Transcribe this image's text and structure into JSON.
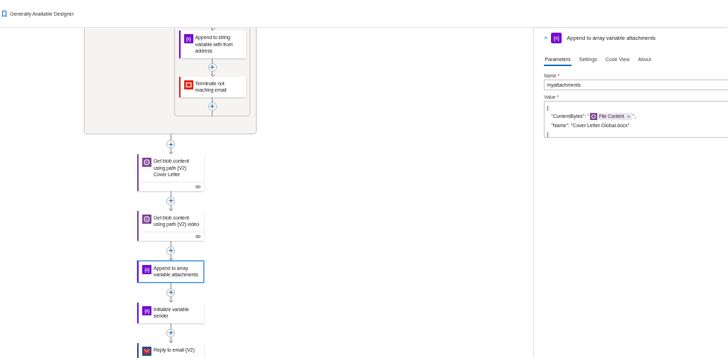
{
  "top_bar": {
    "title": "Generally Available Designer"
  },
  "scope_actions": [
    {
      "title": "Append to string variable with from address",
      "kind": "variable",
      "icon_text": "{x}",
      "color": "#770bd6",
      "selected": false
    },
    {
      "title": "Terminate not maching email",
      "kind": "terminate",
      "color": "#e8271a",
      "selected": false
    }
  ],
  "actions": [
    {
      "title": "Get blob content using path (V2) Cover Letter",
      "kind": "blob",
      "color": "#804998",
      "selected": false,
      "has_footer": true
    },
    {
      "title": "Get blob content using path (V2) video",
      "kind": "blob",
      "color": "#804998",
      "selected": false,
      "has_footer": true
    },
    {
      "title": "Append to array variable attachments",
      "kind": "variable",
      "icon_text": "{x}",
      "color": "#770bd6",
      "selected": true,
      "has_footer": false
    },
    {
      "title": "Initialize variable sender",
      "kind": "variable",
      "icon_text": "{x}",
      "color": "#770bd6",
      "selected": false,
      "has_footer": false
    },
    {
      "title": "Reply to email (V2)",
      "kind": "outlook",
      "color": "#3b4a7c",
      "selected": false,
      "has_footer": false
    }
  ],
  "panel": {
    "collapse": "»",
    "icon_text": "{x}",
    "title": "Append to array variable attachments",
    "tabs": [
      {
        "label": "Parameters",
        "selected": true
      },
      {
        "label": "Settings",
        "selected": false
      },
      {
        "label": "Code View",
        "selected": false
      },
      {
        "label": "About",
        "selected": false
      }
    ],
    "fields": [
      {
        "label": "Name",
        "required_mark": "*",
        "kind": "input",
        "value": "myattachments"
      },
      {
        "label": "Value",
        "required_mark": "*",
        "kind": "code",
        "lines": [
          [
            {
              "kind": "text",
              "text": "{"
            }
          ],
          [
            {
              "kind": "text",
              "text": "\"ContentBytes\": \""
            },
            {
              "kind": "token",
              "text": "File Content",
              "remove": "×"
            },
            {
              "kind": "text",
              "text": "\","
            }
          ],
          [
            {
              "kind": "text",
              "text": "\"Name\": \"Cover Letter Global.docx\""
            }
          ],
          [
            {
              "kind": "text",
              "text": "}"
            }
          ]
        ]
      }
    ]
  }
}
